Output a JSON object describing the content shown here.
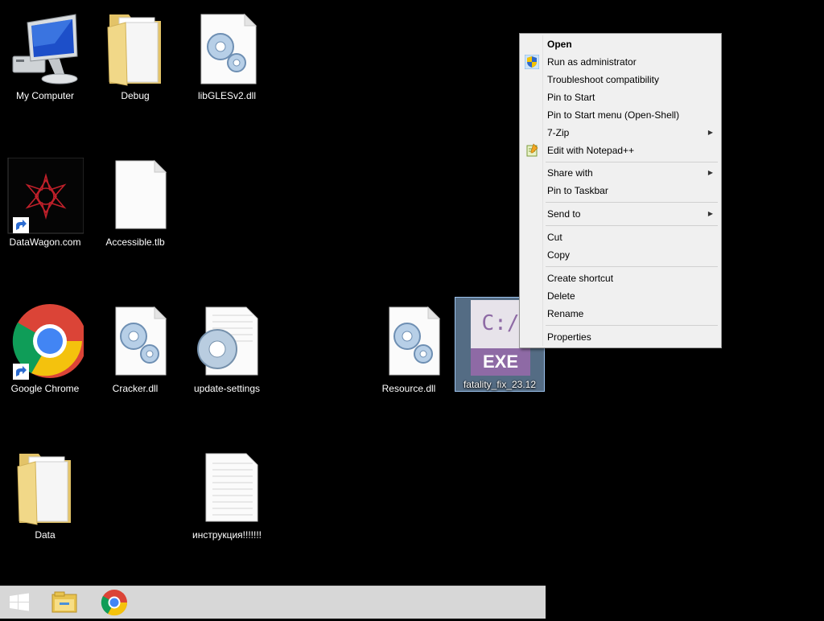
{
  "desktop": {
    "icons": [
      {
        "label": "My Computer"
      },
      {
        "label": "Debug"
      },
      {
        "label": "libGLESv2.dll"
      },
      {
        "label": "DataWagon.com"
      },
      {
        "label": "Accessible.tlb"
      },
      {
        "label": "Google Chrome"
      },
      {
        "label": "Cracker.dll"
      },
      {
        "label": "update-settings"
      },
      {
        "label": "Resource.dll"
      },
      {
        "label": "fatality_fix_23.12"
      },
      {
        "label": "Data"
      },
      {
        "label": "инструкция!!!!!!!"
      }
    ],
    "exe_icon": {
      "top_text": "C:/",
      "bottom_text": "EXE"
    }
  },
  "context_menu": {
    "items": [
      {
        "label": "Open"
      },
      {
        "label": "Run as administrator"
      },
      {
        "label": "Troubleshoot compatibility"
      },
      {
        "label": "Pin to Start"
      },
      {
        "label": "Pin to Start menu (Open-Shell)"
      },
      {
        "label": "7-Zip"
      },
      {
        "label": "Edit with Notepad++"
      },
      {
        "label": "Share with"
      },
      {
        "label": "Pin to Taskbar"
      },
      {
        "label": "Send to"
      },
      {
        "label": "Cut"
      },
      {
        "label": "Copy"
      },
      {
        "label": "Create shortcut"
      },
      {
        "label": "Delete"
      },
      {
        "label": "Rename"
      },
      {
        "label": "Properties"
      }
    ],
    "submenu_arrow": "▶"
  },
  "taskbar": {
    "buttons": [
      {
        "icon": "windows-start-icon"
      },
      {
        "icon": "file-explorer-icon"
      },
      {
        "icon": "chrome-icon"
      }
    ]
  },
  "colors": {
    "desktop_bg": "#000000",
    "menu_bg": "#f0f0f0",
    "selection": "#99c4f0",
    "exe_purple": "#8e6aa5",
    "taskbar_bg": "#d7d7d7"
  }
}
